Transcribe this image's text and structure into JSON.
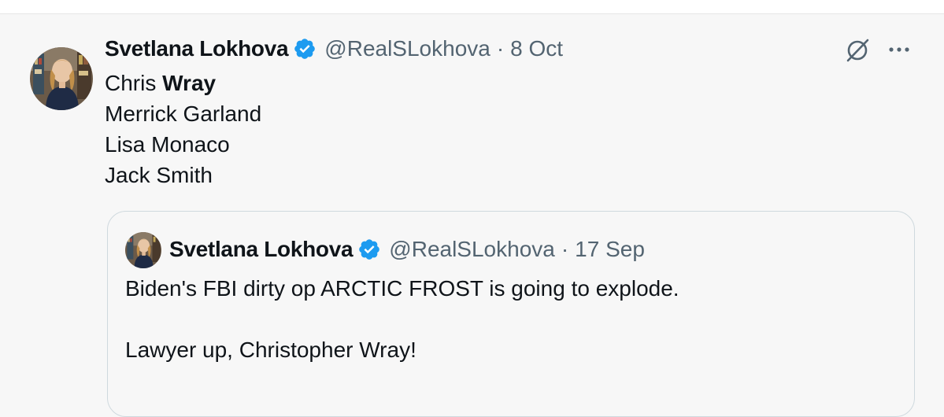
{
  "post": {
    "author_name": "Svetlana Lokhova",
    "handle": "@RealSLokhova",
    "separator": "·",
    "date": "8 Oct",
    "lines": [
      {
        "prefix": "Chris ",
        "bold": "Wray"
      },
      {
        "text": "Merrick Garland"
      },
      {
        "text": "Lisa Monaco"
      },
      {
        "text": "Jack Smith"
      }
    ],
    "grok_icon": "grok-icon",
    "more_icon": "more-horizontal-icon",
    "verified_icon": "verified-badge-icon"
  },
  "quote": {
    "author_name": "Svetlana Lokhova",
    "handle": "@RealSLokhova",
    "separator": "·",
    "date": "17 Sep",
    "lines": [
      "Biden's FBI dirty op ARCTIC FROST is going to explode.",
      "",
      "Lawyer up, Christopher Wray!"
    ]
  },
  "colors": {
    "background": "#f7f7f7",
    "text": "#0f1419",
    "secondary": "#536471",
    "verified": "#1d9bf0",
    "border": "#cfd9de"
  }
}
